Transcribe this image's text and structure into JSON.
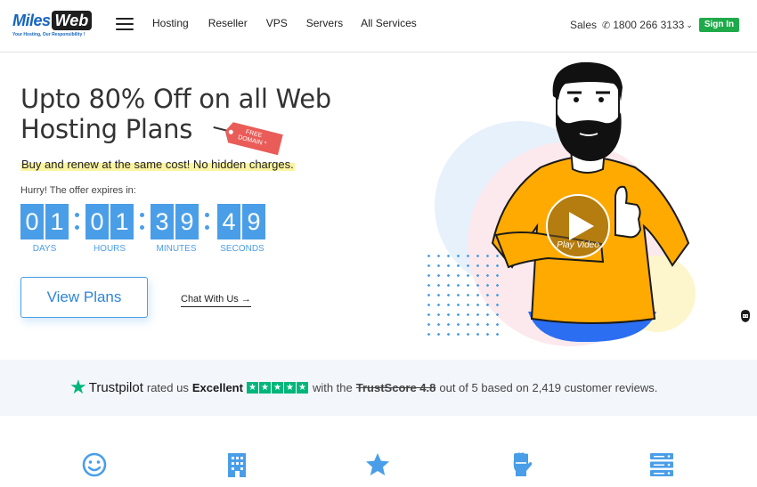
{
  "header": {
    "logo": {
      "brand_part1": "Miles",
      "brand_part2": "Web",
      "tagline": "Your Hosting, Our Responsibility !"
    },
    "nav": [
      "Hosting",
      "Reseller",
      "VPS",
      "Servers",
      "All Services"
    ],
    "sales_label": "Sales",
    "phone": "1800 266 3133",
    "signin_label": "Sign In"
  },
  "hero": {
    "title": "Upto 80% Off on all Web Hosting Plans",
    "tag_line1": "FREE",
    "tag_line2": "DOMAIN *",
    "highlight": "Buy and renew at the same cost! No hidden charges.",
    "expires_text": "Hurry! The offer expires in:",
    "countdown": {
      "days": [
        "0",
        "1"
      ],
      "hours": [
        "0",
        "1"
      ],
      "minutes": [
        "3",
        "9"
      ],
      "seconds": [
        "4",
        "9"
      ],
      "labels": {
        "days": "DAYS",
        "hours": "HOURS",
        "minutes": "MINUTES",
        "seconds": "SECONDS"
      }
    },
    "view_plans_label": "View Plans",
    "chat_label": "Chat With Us",
    "chat_arrow": "→",
    "play_label": "Play Video"
  },
  "trust": {
    "brand": "Trustpilot",
    "rated": "rated us",
    "rating_word": "Excellent",
    "with_the": "with the",
    "trustscore": "TrustScore 4.8",
    "suffix": "out of 5 based on 2,419 customer reviews."
  },
  "features": {
    "icons": [
      "smile-icon",
      "building-icon",
      "star-icon",
      "fist-icon",
      "server-icon"
    ],
    "accent": "#4a9ee8"
  },
  "colors": {
    "accent_blue": "#4a9ee8",
    "signin_green": "#1faa4a",
    "trustpilot_green": "#00b67a",
    "tag_red": "#ea5c58",
    "shirt_orange": "#ffaa00"
  }
}
